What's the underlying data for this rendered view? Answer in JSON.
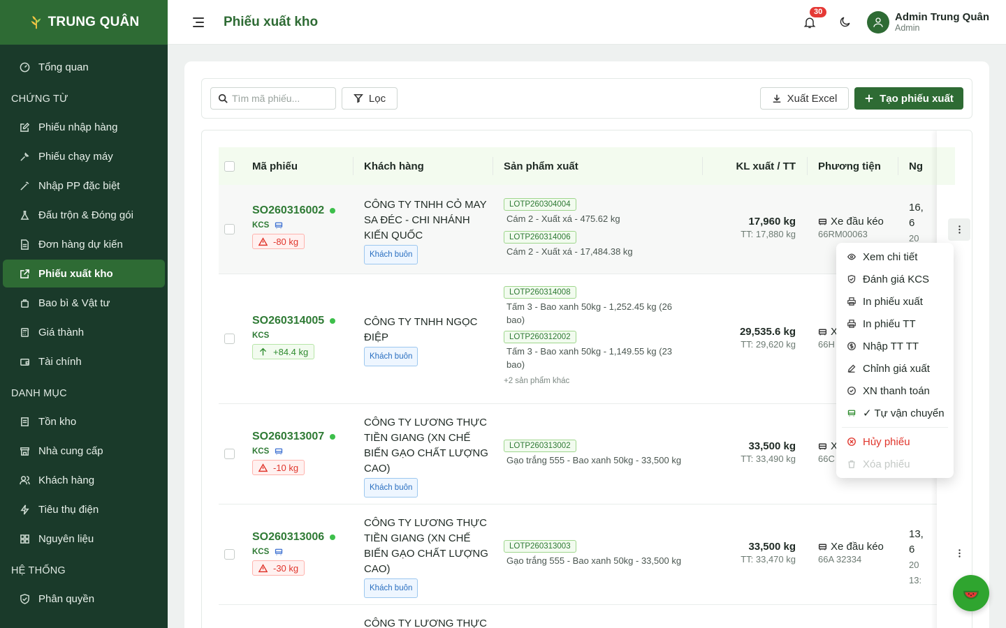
{
  "brand": {
    "name": "TRUNG QUÂN"
  },
  "sidebar": {
    "top_items": [
      {
        "label": "Tổng quan",
        "icon": "dashboard-icon"
      }
    ],
    "sections": [
      {
        "title": "CHỨNG TỪ",
        "items": [
          {
            "label": "Phiếu nhập hàng",
            "icon": "edit-icon"
          },
          {
            "label": "Phiếu chạy máy",
            "icon": "tool-icon"
          },
          {
            "label": "Nhập PP đặc biệt",
            "icon": "wand-icon"
          },
          {
            "label": "Đấu trộn & Đóng gói",
            "icon": "flask-icon"
          },
          {
            "label": "Đơn hàng dự kiến",
            "icon": "document-icon"
          },
          {
            "label": "Phiếu xuất kho",
            "icon": "export-icon",
            "active": true
          },
          {
            "label": "Bao bì & Vật tư",
            "icon": "bag-icon"
          },
          {
            "label": "Giá thành",
            "icon": "calculator-icon"
          },
          {
            "label": "Tài chính",
            "icon": "wallet-icon"
          }
        ]
      },
      {
        "title": "DANH MỤC",
        "items": [
          {
            "label": "Tồn kho",
            "icon": "inventory-icon"
          },
          {
            "label": "Nhà cung cấp",
            "icon": "store-icon"
          },
          {
            "label": "Khách hàng",
            "icon": "users-icon"
          },
          {
            "label": "Tiêu thụ điện",
            "icon": "lightning-icon"
          },
          {
            "label": "Nguyên liệu",
            "icon": "grid-icon"
          }
        ]
      },
      {
        "title": "HỆ THỐNG",
        "items": [
          {
            "label": "Phân quyền",
            "icon": "shield-icon"
          }
        ]
      }
    ]
  },
  "header": {
    "title": "Phiếu xuất kho",
    "notification_count": "30",
    "user_name": "Admin Trung Quân",
    "user_role": "Admin"
  },
  "toolbar": {
    "search_placeholder": "Tìm mã phiếu...",
    "filter_label": "Lọc",
    "excel_label": "Xuất Excel",
    "create_label": "Tạo phiếu xuất"
  },
  "table": {
    "columns": [
      "Mã phiếu",
      "Khách hàng",
      "Sản phẩm xuất",
      "KL xuất / TT",
      "Phương tiện",
      "Ng"
    ],
    "rows": [
      {
        "code": "SO260316002",
        "kcs": "KCS",
        "diff": "-80 kg",
        "diff_type": "neg",
        "customer": "CÔNG TY TNHH CỎ MAY SA ĐÉC - CHI NHÁNH KIẾN QUỐC",
        "customer_tag": "Khách buôn",
        "products": [
          {
            "lot": "LOTP260304004",
            "desc": "Cám 2 - Xuất xá - 475.62 kg"
          },
          {
            "lot": "LOTP260314006",
            "desc": "Cám 2 - Xuất xá - 17,484.38 kg"
          }
        ],
        "weight": "17,960 kg",
        "tt": "TT: 17,880 kg",
        "vehicle": "Xe đầu kéo",
        "plate": "66RM00063",
        "date_1": "16,",
        "date_2": "6",
        "date_3": "20"
      },
      {
        "code": "SO260314005",
        "kcs": "KCS",
        "diff": "+84.4 kg",
        "diff_type": "pos",
        "customer": "CÔNG TY TNHH NGỌC ĐIỆP",
        "customer_tag": "Khách buôn",
        "products": [
          {
            "lot": "LOTP260314008",
            "desc": "Tấm 3 - Bao xanh 50kg - 1,252.45 kg (26 bao)"
          },
          {
            "lot": "LOTP260312002",
            "desc": "Tấm 3 - Bao xanh 50kg - 1,149.55 kg (23 bao)"
          }
        ],
        "more": "+2 sản phẩm khác",
        "weight": "29,535.6 kg",
        "tt": "TT: 29,620 kg",
        "vehicle": "X",
        "plate": "66H"
      },
      {
        "code": "SO260313007",
        "kcs": "KCS",
        "diff": "-10 kg",
        "diff_type": "neg",
        "customer": "CÔNG TY LƯƠNG THỰC TIỀN GIANG (XN CHẾ BIẾN GẠO CHẤT LƯỢNG CAO)",
        "customer_tag": "Khách buôn",
        "products": [
          {
            "lot": "LOTP260313002",
            "desc": "Gạo trắng 555 - Bao xanh 50kg - 33,500 kg"
          }
        ],
        "weight": "33,500 kg",
        "tt": "TT: 33,490 kg",
        "vehicle": "X",
        "plate": "66C"
      },
      {
        "code": "SO260313006",
        "kcs": "KCS",
        "diff": "-30 kg",
        "diff_type": "neg",
        "customer": "CÔNG TY LƯƠNG THỰC TIỀN GIANG (XN CHẾ BIẾN GẠO CHẤT LƯỢNG CAO)",
        "customer_tag": "Khách buôn",
        "products": [
          {
            "lot": "LOTP260313003",
            "desc": "Gạo trắng 555 - Bao xanh 50kg - 33,500 kg"
          }
        ],
        "weight": "33,500 kg",
        "tt": "TT: 33,470 kg",
        "vehicle": "Xe đầu kéo",
        "plate": "66A 32334",
        "date_1": "13,",
        "date_2": "6",
        "date_3": "20",
        "date_4": "13:"
      },
      {
        "customer": "CÔNG TY LƯƠNG THỰC"
      }
    ]
  },
  "row_menu": {
    "items": [
      {
        "label": "Xem chi tiết",
        "icon": "eye-icon"
      },
      {
        "label": "Đánh giá KCS",
        "icon": "shield-check-icon"
      },
      {
        "label": "In phiếu xuất",
        "icon": "printer-icon"
      },
      {
        "label": "In phiếu TT",
        "icon": "printer-icon"
      },
      {
        "label": "Nhập TT TT",
        "icon": "dollar-icon"
      },
      {
        "label": "Chỉnh giá xuất",
        "icon": "pencil-icon"
      },
      {
        "label": "XN thanh toán",
        "icon": "check-circle-icon"
      },
      {
        "label": "✓ Tự vận chuyển",
        "icon": "truck-icon"
      }
    ],
    "cancel_label": "Hủy phiếu",
    "delete_label": "Xóa phiếu"
  },
  "colors": {
    "brand": "#2e6b34",
    "sidebar_bg": "#1a3a2a",
    "danger": "#e0352b",
    "accent_green": "#2e7a34"
  }
}
